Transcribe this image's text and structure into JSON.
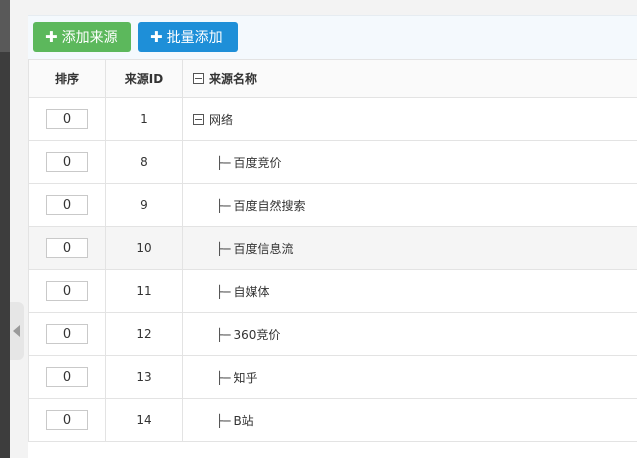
{
  "toolbar": {
    "add_label": "添加来源",
    "batch_add_label": "批量添加"
  },
  "table": {
    "headers": {
      "order": "排序",
      "id": "来源ID",
      "name": "来源名称"
    },
    "rows": [
      {
        "order": "0",
        "id": "1",
        "name": "网络",
        "level": 0
      },
      {
        "order": "0",
        "id": "8",
        "name": "百度竞价",
        "level": 1
      },
      {
        "order": "0",
        "id": "9",
        "name": "百度自然搜索",
        "level": 1
      },
      {
        "order": "0",
        "id": "10",
        "name": "百度信息流",
        "level": 1
      },
      {
        "order": "0",
        "id": "11",
        "name": "自媒体",
        "level": 1
      },
      {
        "order": "0",
        "id": "12",
        "name": "360竞价",
        "level": 1
      },
      {
        "order": "0",
        "id": "13",
        "name": "知乎",
        "level": 1
      },
      {
        "order": "0",
        "id": "14",
        "name": "B站",
        "level": 1
      }
    ],
    "tree_branch": "├─"
  },
  "colors": {
    "green": "#5cb85c",
    "blue": "#1e8fd8"
  },
  "icons": {
    "add": "plus-icon",
    "collapse": "minus-box-icon",
    "sidebar_toggle": "triangle-left-icon"
  }
}
